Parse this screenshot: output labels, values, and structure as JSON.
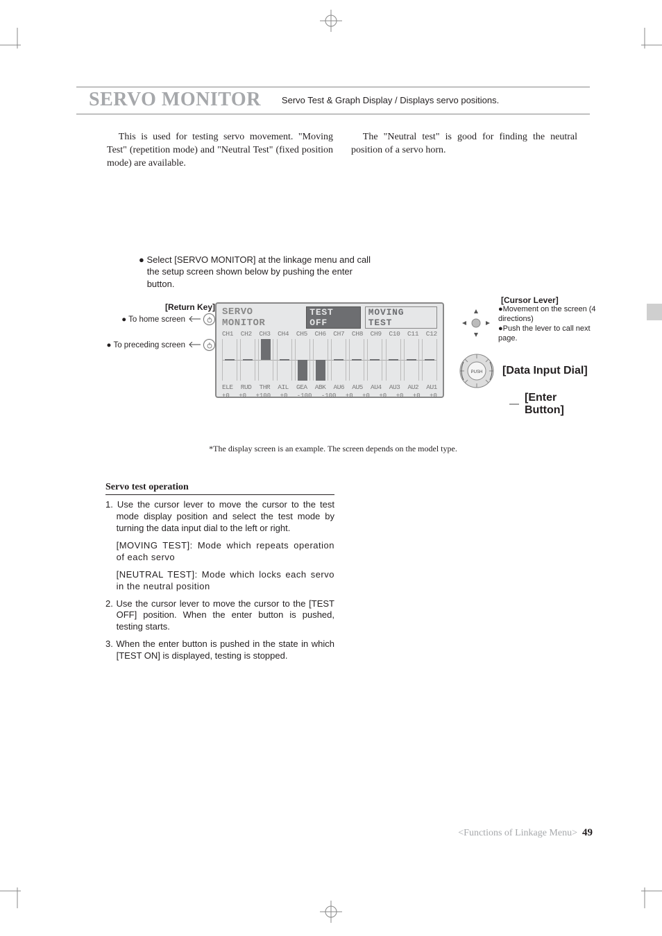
{
  "header": {
    "title": "SERVO MONITOR",
    "subtitle": "Servo Test & Graph Display / Displays servo positions."
  },
  "intro": {
    "left": "This is used for testing servo movement. \"Moving Test\" (repetition mode) and \"Neutral Test\" (fixed position mode) are available.",
    "right": "The \"Neutral test\" is good for finding the neutral position of a servo horn."
  },
  "select_note": "● Select [SERVO MONITOR] at the linkage menu and call the setup screen shown below by pushing the enter button.",
  "return_key": {
    "heading": "[Return Key]",
    "line1_label": "To home screen",
    "line2_label": "To preceding screen"
  },
  "cursor": {
    "heading": "[Cursor Lever]",
    "line1": "●Movement on the screen (4 directions)",
    "line2": "●Push the lever to call next page."
  },
  "dial_label": "[Data Input Dial]",
  "enter_label": "[Enter Button]",
  "dial_push": "PUSH",
  "lcd": {
    "title": "SERVO MONITOR",
    "badge": "TEST OFF",
    "mode": "MOVING TEST",
    "channels": [
      "CH1",
      "CH2",
      "CH3",
      "CH4",
      "CH5",
      "CH6",
      "CH7",
      "CH8",
      "CH9",
      "C10",
      "C11",
      "C12"
    ],
    "labels": [
      "ELE",
      "RUD",
      "THR",
      "AIL",
      "GEA",
      "ABK",
      "AU6",
      "AU5",
      "AU4",
      "AU3",
      "AU2",
      "AU1"
    ],
    "values": [
      "+0",
      "+0",
      "+100",
      "+0",
      "-100",
      "-100",
      "+0",
      "+0",
      "+0",
      "+0",
      "+0",
      "+0"
    ]
  },
  "footnote": "*The display screen is an example. The screen depends on the model type.",
  "ops": {
    "heading": "Servo test operation",
    "step1": "1. Use the cursor lever to move the cursor to the test mode display position and select the test mode by turning the data input dial to the left or right.",
    "step1a": "[MOVING TEST]: Mode which repeats operation of each servo",
    "step1b": "[NEUTRAL TEST]: Mode which locks each servo in the neutral position",
    "step2": "2. Use the cursor lever to move the cursor to the [TEST OFF] position. When the enter button is pushed, testing starts.",
    "step3": "3. When the enter button is pushed in the state in which [TEST ON] is displayed, testing is stopped."
  },
  "footer": {
    "section": "<Functions of Linkage Menu>",
    "page": "49"
  },
  "chart_data": {
    "type": "bar",
    "title": "SERVO MONITOR TEST OFF MOVING TEST",
    "categories": [
      "CH1/ELE",
      "CH2/RUD",
      "CH3/THR",
      "CH4/AIL",
      "CH5/GEA",
      "CH6/ABK",
      "CH7/AU6",
      "CH8/AU5",
      "CH9/AU4",
      "C10/AU3",
      "C11/AU2",
      "C12/AU1"
    ],
    "values": [
      0,
      0,
      100,
      0,
      -100,
      -100,
      0,
      0,
      0,
      0,
      0,
      0
    ],
    "ylim": [
      -100,
      100
    ],
    "xlabel": "",
    "ylabel": ""
  }
}
